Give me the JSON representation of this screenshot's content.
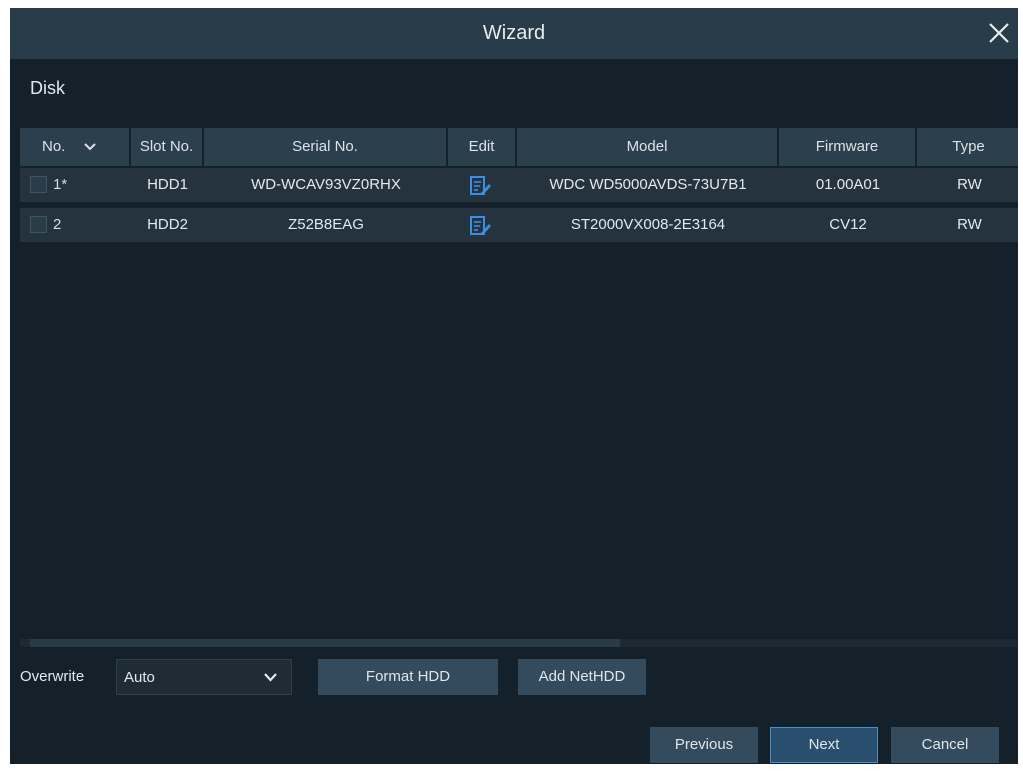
{
  "window": {
    "title": "Wizard"
  },
  "section": {
    "label": "Disk"
  },
  "table": {
    "columns": [
      "No.",
      "Slot No.",
      "Serial No.",
      "Edit",
      "Model",
      "Firmware",
      "Type"
    ],
    "rows": [
      {
        "no": "1*",
        "slot": "HDD1",
        "serial": "WD-WCAV93VZ0RHX",
        "model": "WDC WD5000AVDS-73U7B1",
        "firmware": "01.00A01",
        "type": "RW",
        "checked": false
      },
      {
        "no": "2",
        "slot": "HDD2",
        "serial": "Z52B8EAG",
        "model": "ST2000VX008-2E3164",
        "firmware": "CV12",
        "type": "RW",
        "checked": false
      }
    ]
  },
  "overwrite": {
    "label": "Overwrite",
    "value": "Auto"
  },
  "buttons": {
    "format_hdd": "Format HDD",
    "add_nethdd": "Add NetHDD",
    "previous": "Previous",
    "next": "Next",
    "cancel": "Cancel"
  },
  "colors": {
    "background": "#15212a",
    "titlebar": "#283c4a",
    "header": "#2c3f4d",
    "row": "#25333e",
    "button": "#334b5c",
    "accent_border": "#4a8fc8",
    "edit_icon": "#3a8ee6"
  },
  "icons": {
    "close": "close-icon",
    "edit": "edit-icon",
    "dropdown": "chevron-down-icon"
  }
}
